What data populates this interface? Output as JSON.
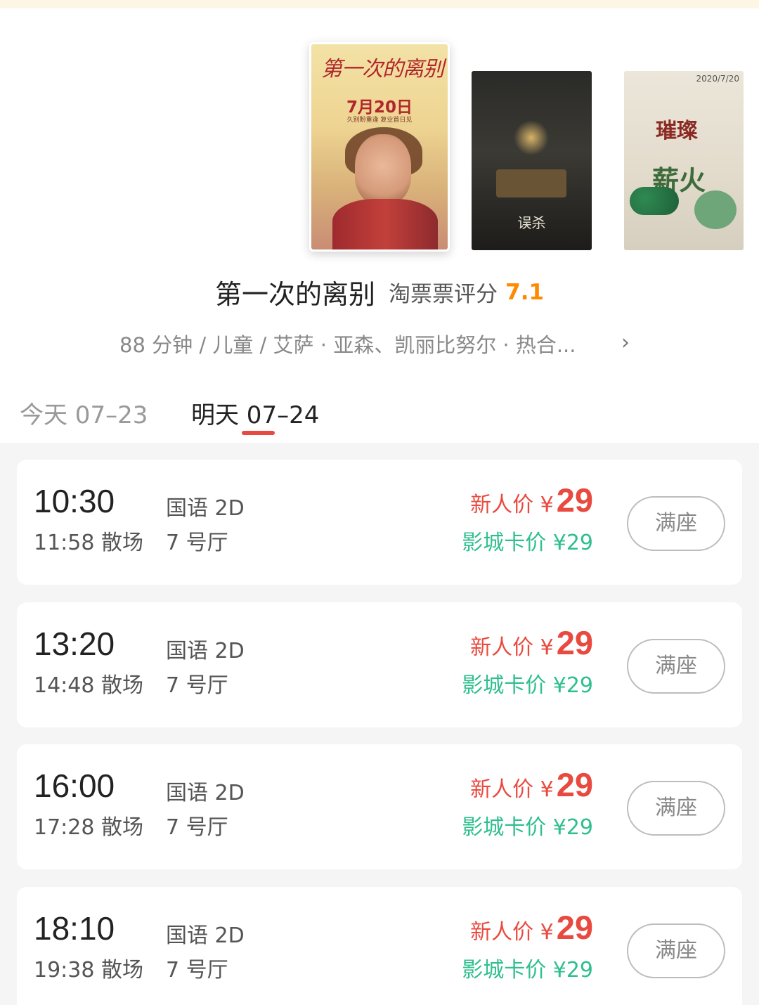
{
  "posters": [
    {
      "title": "第一次的离别",
      "date": "7月20日",
      "tagline": "久别盼重逢  复业首日见"
    },
    {
      "title": "误杀"
    },
    {
      "date": "2020/7/20",
      "title_top": "璀璨",
      "title_bottom": "薪火"
    }
  ],
  "movie": {
    "name": "第一次的离别",
    "rating_label": "淘票票评分",
    "rating_value": "7.1",
    "meta": "88 分钟 / 儿童 / 艾萨 · 亚森、凯丽比努尔 · 热合...",
    "meta_arrow": "›"
  },
  "tabs": {
    "today": "今天 07–23",
    "tomorrow": "明天 07–24"
  },
  "showtimes": [
    {
      "start": "10:30",
      "end": "11:58 散场",
      "lang": "国语 2D",
      "hall": "7 号厅",
      "price_label": "新人价 ¥",
      "price": "29",
      "card_price": "影城卡价 ¥29",
      "button": "满座"
    },
    {
      "start": "13:20",
      "end": "14:48 散场",
      "lang": "国语 2D",
      "hall": "7 号厅",
      "price_label": "新人价 ¥",
      "price": "29",
      "card_price": "影城卡价 ¥29",
      "button": "满座"
    },
    {
      "start": "16:00",
      "end": "17:28 散场",
      "lang": "国语 2D",
      "hall": "7 号厅",
      "price_label": "新人价 ¥",
      "price": "29",
      "card_price": "影城卡价 ¥29",
      "button": "满座"
    },
    {
      "start": "18:10",
      "end": "19:38 散场",
      "lang": "国语 2D",
      "hall": "7 号厅",
      "price_label": "新人价 ¥",
      "price": "29",
      "card_price": "影城卡价 ¥29",
      "button": "满座"
    }
  ],
  "colors": {
    "accent_red": "#e94a3f",
    "rating_orange": "#ff8a00",
    "card_price_green": "#2fbf8f"
  }
}
